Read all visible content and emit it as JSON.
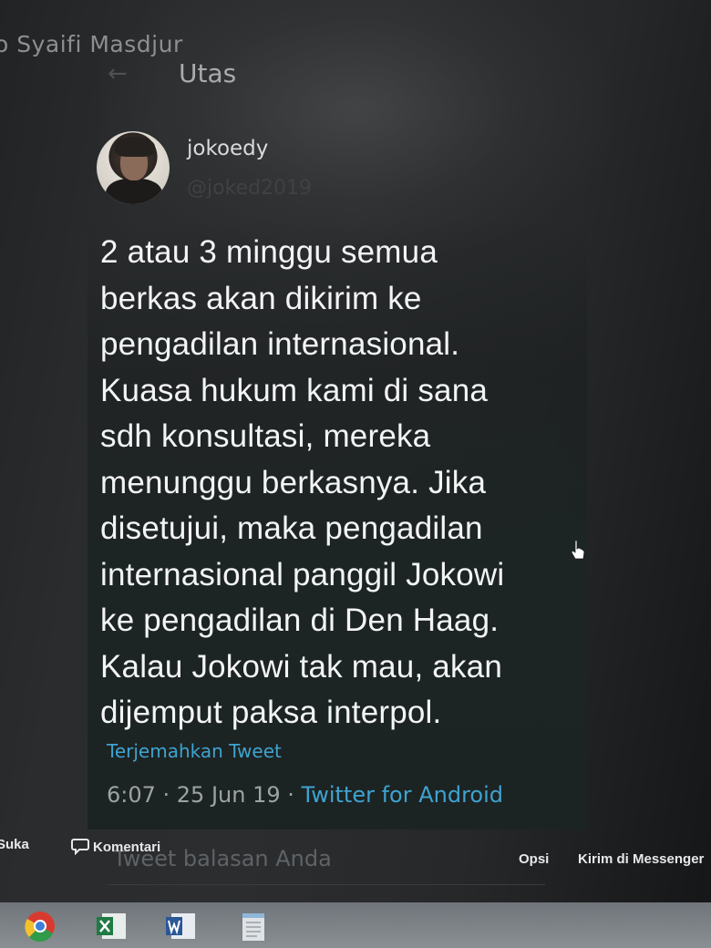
{
  "facebook_post": {
    "author_fragment": "o Syaifi Masdjur"
  },
  "thread_header": {
    "back_icon": "arrow-left-icon",
    "title": "Utas"
  },
  "tweet": {
    "display_name": "jokoedy",
    "username": "@joked2019",
    "text": "2 atau 3 minggu semua\nberkas akan dikirim ke\npengadilan internasional.\nKuasa hukum kami di sana\nsdh konsultasi, mereka\nmenunggu berkasnya. Jika\ndisetujui, maka pengadilan\ninternasional panggil Jokowi\nke pengadilan di Den Haag.\nKalau Jokowi tak mau,  akan\ndijemput paksa interpol.",
    "translate_link": "Terjemahkan Tweet",
    "time_date": "6:07 · 25 Jun 19 · ",
    "source": "Twitter for Android",
    "reply_placeholder": "Tweet balasan Anda"
  },
  "fb_actions": {
    "like_label": "Suka",
    "comment_label": "Komentari",
    "options_label": "Opsi",
    "send_messenger_label": "Kirim di Messenger"
  },
  "taskbar": {
    "apps": [
      "chrome-icon",
      "excel-icon",
      "word-icon",
      "notepad-icon"
    ]
  },
  "colors": {
    "link": "#3fa3cf",
    "background": "#2b2d2f",
    "text": "#f3f4f4"
  }
}
